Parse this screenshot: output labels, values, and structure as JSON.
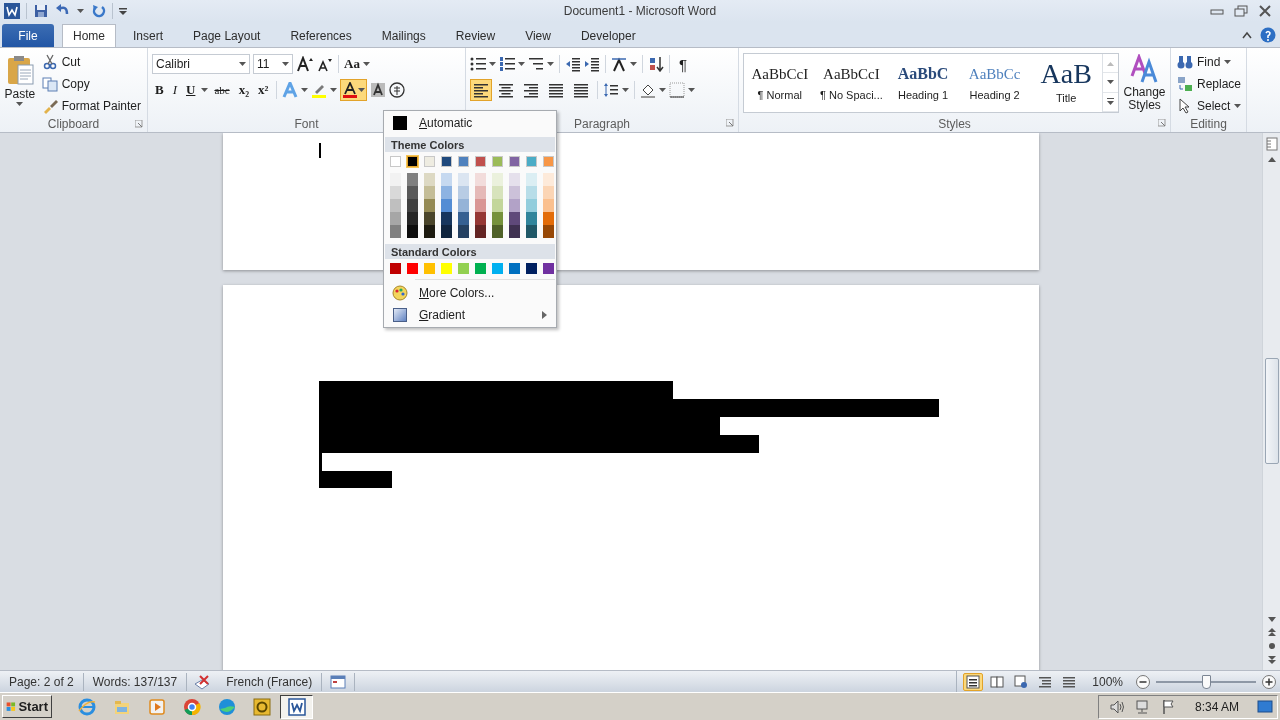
{
  "window": {
    "title": "Document1 - Microsoft Word"
  },
  "tabs": [
    {
      "label": "File",
      "kind": "file",
      "selected": false
    },
    {
      "label": "Home",
      "kind": "tab",
      "selected": true
    },
    {
      "label": "Insert",
      "kind": "tab",
      "selected": false
    },
    {
      "label": "Page Layout",
      "kind": "tab",
      "selected": false
    },
    {
      "label": "References",
      "kind": "tab",
      "selected": false
    },
    {
      "label": "Mailings",
      "kind": "tab",
      "selected": false
    },
    {
      "label": "Review",
      "kind": "tab",
      "selected": false
    },
    {
      "label": "View",
      "kind": "tab",
      "selected": false
    },
    {
      "label": "Developer",
      "kind": "tab",
      "selected": false
    }
  ],
  "clipboard": {
    "paste": "Paste",
    "commands": [
      "Cut",
      "Copy",
      "Format Painter"
    ],
    "label": "Clipboard"
  },
  "font": {
    "name": "Calibri",
    "size": "11",
    "change_case": "Aa",
    "formats": [
      "B",
      "I",
      "U",
      "abc",
      "x₂",
      "x²"
    ],
    "font_color_open": true,
    "label": "Font"
  },
  "paragraph": {
    "pilcrow": "¶",
    "alignments": [
      {
        "selected": true
      },
      {
        "selected": false
      },
      {
        "selected": false
      },
      {
        "selected": false
      },
      {
        "selected": false
      }
    ],
    "label": "Paragraph"
  },
  "styles": {
    "items": [
      {
        "kind": "normal",
        "sample": "AaBbCcI",
        "name": "¶ Normal"
      },
      {
        "kind": "normal",
        "sample": "AaBbCcI",
        "name": "¶ No Spaci..."
      },
      {
        "kind": "heading1",
        "sample": "AaBbC",
        "name": "Heading 1"
      },
      {
        "kind": "heading2",
        "sample": "AaBbCc",
        "name": "Heading 2"
      },
      {
        "kind": "title",
        "sample": "AaB",
        "name": "Title"
      }
    ],
    "change_styles": "Change Styles",
    "label": "Styles"
  },
  "editing": {
    "commands": [
      "Find",
      "Replace",
      "Select"
    ],
    "label": "Editing"
  },
  "color_menu": {
    "automatic": "Automatic",
    "theme_title": "Theme Colors",
    "theme": [
      {
        "color": "#ffffff",
        "selected": false
      },
      {
        "color": "#000000",
        "selected": true
      },
      {
        "color": "#eeece1",
        "selected": false
      },
      {
        "color": "#1f497d",
        "selected": false
      },
      {
        "color": "#4f81bd",
        "selected": false
      },
      {
        "color": "#c0504d",
        "selected": false
      },
      {
        "color": "#9bbb59",
        "selected": false
      },
      {
        "color": "#8064a2",
        "selected": false
      },
      {
        "color": "#4bacc6",
        "selected": false
      },
      {
        "color": "#f79646",
        "selected": false
      }
    ],
    "shades": [
      {
        "tints": [
          {
            "color": "#f2f2f2"
          },
          {
            "color": "#d9d9d9"
          },
          {
            "color": "#bfbfbf"
          },
          {
            "color": "#a6a6a6"
          },
          {
            "color": "#808080"
          }
        ]
      },
      {
        "tints": [
          {
            "color": "#7f7f7f"
          },
          {
            "color": "#595959"
          },
          {
            "color": "#404040"
          },
          {
            "color": "#262626"
          },
          {
            "color": "#0d0d0d"
          }
        ]
      },
      {
        "tints": [
          {
            "color": "#ddd9c3"
          },
          {
            "color": "#c4bd97"
          },
          {
            "color": "#948a54"
          },
          {
            "color": "#4a452a"
          },
          {
            "color": "#1d1b10"
          }
        ]
      },
      {
        "tints": [
          {
            "color": "#c6d9f0"
          },
          {
            "color": "#8db3e2"
          },
          {
            "color": "#548dd4"
          },
          {
            "color": "#17365d"
          },
          {
            "color": "#0f243e"
          }
        ]
      },
      {
        "tints": [
          {
            "color": "#dbe5f1"
          },
          {
            "color": "#b8cce4"
          },
          {
            "color": "#95b3d7"
          },
          {
            "color": "#366092"
          },
          {
            "color": "#244061"
          }
        ]
      },
      {
        "tints": [
          {
            "color": "#f2dcdb"
          },
          {
            "color": "#e5b9b7"
          },
          {
            "color": "#d99694"
          },
          {
            "color": "#953734"
          },
          {
            "color": "#632423"
          }
        ]
      },
      {
        "tints": [
          {
            "color": "#ebf1dd"
          },
          {
            "color": "#d7e3bc"
          },
          {
            "color": "#c3d69b"
          },
          {
            "color": "#76923c"
          },
          {
            "color": "#4f6128"
          }
        ]
      },
      {
        "tints": [
          {
            "color": "#e5e0ec"
          },
          {
            "color": "#ccc1d9"
          },
          {
            "color": "#b2a2c7"
          },
          {
            "color": "#5f497a"
          },
          {
            "color": "#3f3151"
          }
        ]
      },
      {
        "tints": [
          {
            "color": "#dbeef3"
          },
          {
            "color": "#b7dde8"
          },
          {
            "color": "#92cddc"
          },
          {
            "color": "#31859b"
          },
          {
            "color": "#205867"
          }
        ]
      },
      {
        "tints": [
          {
            "color": "#fdeada"
          },
          {
            "color": "#fbd5b5"
          },
          {
            "color": "#fac08f"
          },
          {
            "color": "#e36c09"
          },
          {
            "color": "#974806"
          }
        ]
      }
    ],
    "standard_title": "Standard Colors",
    "standard": [
      {
        "color": "#c00000"
      },
      {
        "color": "#ff0000"
      },
      {
        "color": "#ffc000"
      },
      {
        "color": "#ffff00"
      },
      {
        "color": "#92d050"
      },
      {
        "color": "#00b050"
      },
      {
        "color": "#00b0f0"
      },
      {
        "color": "#0070c0"
      },
      {
        "color": "#002060"
      },
      {
        "color": "#7030a0"
      }
    ],
    "more": "More Colors...",
    "gradient": "Gradient"
  },
  "status_bar": {
    "page": "Page: 2 of 2",
    "words": "Words: 137/137",
    "language": "French (France)",
    "views": [
      {
        "selected": true
      },
      {
        "selected": false
      },
      {
        "selected": false
      },
      {
        "selected": false
      },
      {
        "selected": false
      }
    ],
    "zoom": "100%",
    "zoom_slider": {
      "level": 0.5
    }
  },
  "taskbar": {
    "start": "Start",
    "apps": [
      {
        "kind": "ie",
        "selected": false
      },
      {
        "kind": "explorer",
        "selected": false
      },
      {
        "kind": "media",
        "selected": false
      },
      {
        "kind": "chrome",
        "selected": false
      },
      {
        "kind": "edge",
        "selected": false
      },
      {
        "kind": "outlook",
        "selected": false
      },
      {
        "kind": "word",
        "selected": true
      }
    ],
    "clock": "8:34 AM"
  }
}
